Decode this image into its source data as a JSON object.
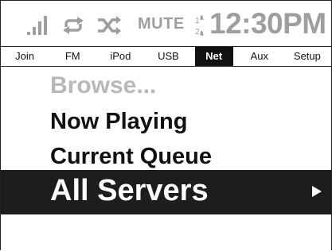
{
  "status_bar": {
    "mute_label": "MUTE",
    "alarm_top": "1",
    "alarm_bottom": "2",
    "time": "12:30PM",
    "icons": [
      "signal-strength-icon",
      "repeat-icon",
      "shuffle-icon",
      "alarm-icon"
    ],
    "icon_color": "#9e9e9e"
  },
  "tabs": [
    {
      "label": "Join",
      "active": false
    },
    {
      "label": "FM",
      "active": false
    },
    {
      "label": "iPod",
      "active": false
    },
    {
      "label": "USB",
      "active": false
    },
    {
      "label": "Net",
      "active": true
    },
    {
      "label": "Aux",
      "active": false
    },
    {
      "label": "Setup",
      "active": false
    }
  ],
  "menu": {
    "items": [
      {
        "label": "Browse...",
        "state": "disabled"
      },
      {
        "label": "Now Playing",
        "state": "normal"
      },
      {
        "label": "Current Queue",
        "state": "normal"
      },
      {
        "label": "All Servers",
        "state": "selected"
      }
    ],
    "selected_arrow_icon": "right-triangle-icon",
    "selected_background": "#1d1d1d"
  }
}
